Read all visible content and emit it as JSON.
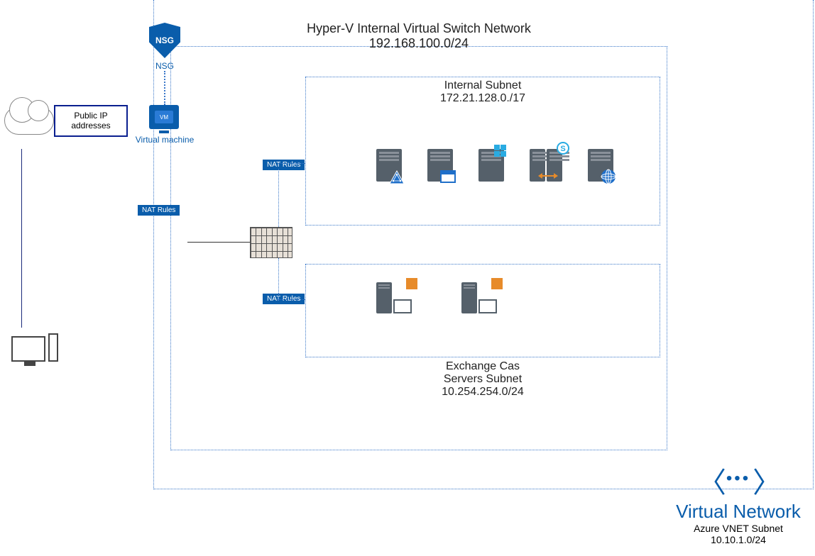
{
  "outer_network": {
    "title": "Hyper-V Internal Virtual Switch Network",
    "cidr": "192.168.100.0/24"
  },
  "internal_subnet": {
    "title": "Internal Subnet",
    "cidr": "172.21.128.0./17"
  },
  "exchange_subnet": {
    "title": "Exchange Cas",
    "title2": "Servers Subnet",
    "cidr": "10.254.254.0/24"
  },
  "vnet": {
    "title": "Virtual Network",
    "subtitle": "Azure VNET Subnet",
    "cidr": "10.10.1.0/24"
  },
  "labels": {
    "nsg_text": "NSG",
    "nsg_caption": "NSG",
    "vm_inner": "VM",
    "vm_caption": "Virtual machine",
    "public_ip_line1": "Public IP",
    "public_ip_line2": "addresses",
    "nat_rules": "NAT Rules"
  },
  "colors": {
    "azure_blue": "#0a5dab",
    "border_blue": "#0a1f8f"
  }
}
